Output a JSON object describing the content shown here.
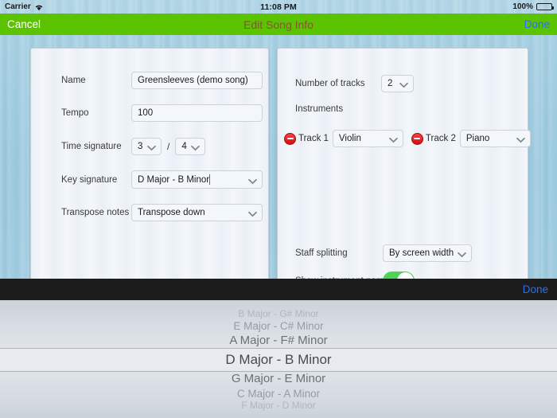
{
  "statusbar": {
    "carrier": "Carrier",
    "wifi_icon": "wifi-icon",
    "time": "11:08 PM",
    "battery_percent": "100%",
    "battery_icon": "battery-full-icon"
  },
  "navbar": {
    "cancel_label": "Cancel",
    "title": "Edit Song Info",
    "done_label": "Done",
    "bg_color": "#5cc300",
    "title_color": "#8e4f3f",
    "done_color": "#2a6ff0"
  },
  "form": {
    "name": {
      "label": "Name",
      "value": "Greensleeves (demo song)"
    },
    "tempo": {
      "label": "Tempo",
      "value": "100"
    },
    "time_signature": {
      "label": "Time signature",
      "numerator": "3",
      "denominator": "4",
      "separator": "/"
    },
    "key_signature": {
      "label": "Key signature",
      "value": "D Major - B Minor",
      "focused": true
    },
    "transpose_notes": {
      "label": "Transpose notes",
      "value": "Transpose down"
    }
  },
  "tracks_panel": {
    "number_of_tracks": {
      "label": "Number of tracks",
      "value": "2"
    },
    "instruments_label": "Instruments",
    "tracks": [
      {
        "remove_icon": "minus-circle-icon",
        "label": "Track 1",
        "instrument": "Violin"
      },
      {
        "remove_icon": "minus-circle-icon",
        "label": "Track 2",
        "instrument": "Piano"
      }
    ],
    "staff_splitting": {
      "label": "Staff splitting",
      "value": "By screen width"
    },
    "show_instrument_name": {
      "label": "Show instrument name",
      "state": "on",
      "color": "#4cd455"
    }
  },
  "picker": {
    "toolbar_done_label": "Done",
    "selected_index": 3,
    "options": [
      "B Major - G# Minor",
      "E Major - C# Minor",
      "A Major - F# Minor",
      "D Major - B Minor",
      "G Major - E Minor",
      "C Major - A Minor",
      "F Major - D Minor"
    ]
  }
}
